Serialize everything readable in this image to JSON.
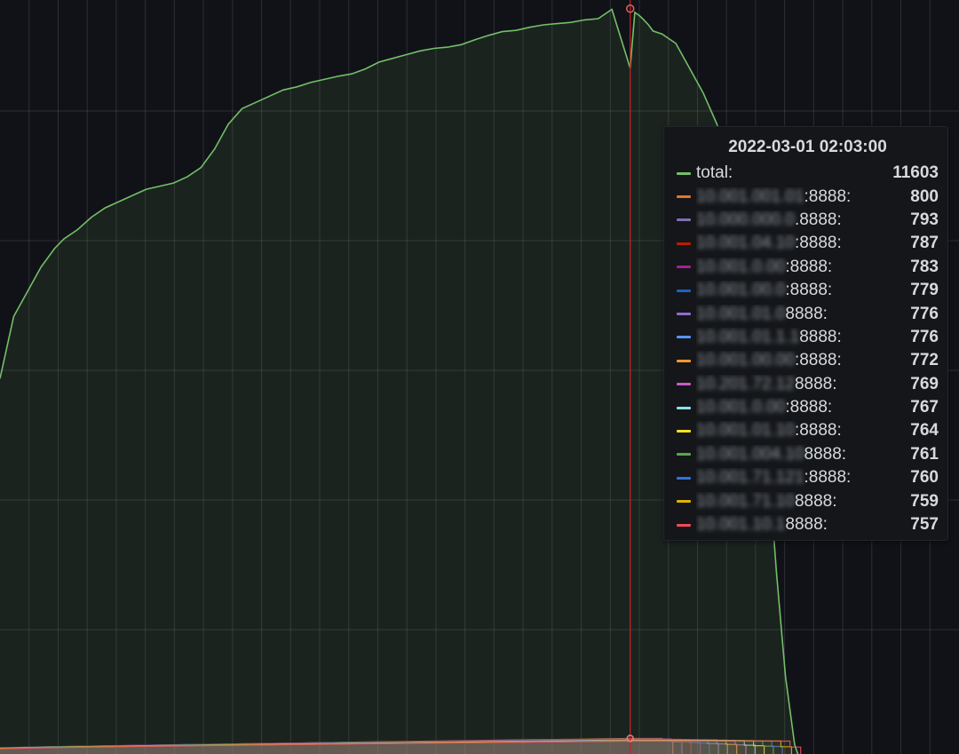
{
  "chart_data": {
    "type": "area",
    "x_range": [
      "2022-02-28 23:45:00",
      "2022-03-01 03:15:00"
    ],
    "hover_time": "2022-03-01 02:03:00",
    "grid": true,
    "series": [
      {
        "name": "total:",
        "color": "#73bf69",
        "points": [
          [
            "2022-02-28 23:45:00",
            6600
          ],
          [
            "2022-02-28 23:48:00",
            7600
          ],
          [
            "2022-02-28 23:51:00",
            8000
          ],
          [
            "2022-02-28 23:54:00",
            8400
          ],
          [
            "2022-02-28 23:57:00",
            8700
          ],
          [
            "2022-02-28 23:59:00",
            8850
          ],
          [
            "2022-03-01 00:02:00",
            9000
          ],
          [
            "2022-03-01 00:05:00",
            9200
          ],
          [
            "2022-03-01 00:08:00",
            9350
          ],
          [
            "2022-03-01 00:11:00",
            9450
          ],
          [
            "2022-03-01 00:14:00",
            9550
          ],
          [
            "2022-03-01 00:17:00",
            9650
          ],
          [
            "2022-03-01 00:20:00",
            9700
          ],
          [
            "2022-03-01 00:23:00",
            9750
          ],
          [
            "2022-03-01 00:26:00",
            9850
          ],
          [
            "2022-03-01 00:29:00",
            10000
          ],
          [
            "2022-03-01 00:32:00",
            10300
          ],
          [
            "2022-03-01 00:35:00",
            10700
          ],
          [
            "2022-03-01 00:38:00",
            10950
          ],
          [
            "2022-03-01 00:41:00",
            11050
          ],
          [
            "2022-03-01 00:44:00",
            11150
          ],
          [
            "2022-03-01 00:47:00",
            11250
          ],
          [
            "2022-03-01 00:50:00",
            11300
          ],
          [
            "2022-03-01 00:53:00",
            11370
          ],
          [
            "2022-03-01 00:56:00",
            11420
          ],
          [
            "2022-03-01 00:59:00",
            11470
          ],
          [
            "2022-03-01 01:02:00",
            11510
          ],
          [
            "2022-03-01 01:05:00",
            11590
          ],
          [
            "2022-03-01 01:08:00",
            11700
          ],
          [
            "2022-03-01 01:11:00",
            11760
          ],
          [
            "2022-03-01 01:14:00",
            11820
          ],
          [
            "2022-03-01 01:17:00",
            11880
          ],
          [
            "2022-03-01 01:20:00",
            11920
          ],
          [
            "2022-03-01 01:23:00",
            11940
          ],
          [
            "2022-03-01 01:26:00",
            11980
          ],
          [
            "2022-03-01 01:29:00",
            12060
          ],
          [
            "2022-03-01 01:32:00",
            12130
          ],
          [
            "2022-03-01 01:35:00",
            12190
          ],
          [
            "2022-03-01 01:38:00",
            12210
          ],
          [
            "2022-03-01 01:41:00",
            12260
          ],
          [
            "2022-03-01 01:44:00",
            12300
          ],
          [
            "2022-03-01 01:47:00",
            12320
          ],
          [
            "2022-03-01 01:50:00",
            12340
          ],
          [
            "2022-03-01 01:53:00",
            12380
          ],
          [
            "2022-03-01 01:56:00",
            12400
          ],
          [
            "2022-03-01 01:59:00",
            12550
          ],
          [
            "2022-03-01 02:03:00",
            11603
          ],
          [
            "2022-03-01 02:04:00",
            12500
          ],
          [
            "2022-03-01 02:05:00",
            12450
          ],
          [
            "2022-03-01 02:06:00",
            12380
          ],
          [
            "2022-03-01 02:07:00",
            12300
          ],
          [
            "2022-03-01 02:08:00",
            12200
          ],
          [
            "2022-03-01 02:10:00",
            12150
          ],
          [
            "2022-03-01 02:13:00",
            12000
          ],
          [
            "2022-03-01 02:16:00",
            11600
          ],
          [
            "2022-03-01 02:19:00",
            11200
          ],
          [
            "2022-03-01 02:22:00",
            10700
          ],
          [
            "2022-03-01 02:25:00",
            10000
          ],
          [
            "2022-03-01 02:28:00",
            9000
          ],
          [
            "2022-03-01 02:31:00",
            7500
          ],
          [
            "2022-03-01 02:33:00",
            5500
          ],
          [
            "2022-03-01 02:35:00",
            3500
          ],
          [
            "2022-03-01 02:37:00",
            1800
          ],
          [
            "2022-03-01 02:39:00",
            700
          ],
          [
            "2022-03-01 02:41:00",
            280
          ],
          [
            "2022-03-01 02:43:00",
            130
          ],
          [
            "2022-03-01 02:46:00",
            90
          ],
          [
            "2022-03-01 02:49:00",
            80
          ],
          [
            "2022-03-01 03:15:00",
            50
          ]
        ]
      }
    ],
    "instances": {
      "x_range": [
        "2022-02-28 23:45:00",
        "2022-03-01 02:03:00"
      ],
      "values_start": [
        640,
        645,
        650,
        642,
        648,
        636,
        639,
        644,
        638,
        641,
        637,
        646,
        633,
        640,
        635
      ],
      "end_times": [
        "2022-03-01 02:10:00",
        "2022-03-01 02:12:00",
        "2022-03-01 02:14:00",
        "2022-03-01 02:16:00",
        "2022-03-01 02:18:00",
        "2022-03-01 02:20:00",
        "2022-03-01 02:22:00",
        "2022-03-01 02:24:00",
        "2022-03-01 02:26:00",
        "2022-03-01 02:28:00",
        "2022-03-01 02:30:00",
        "2022-03-01 02:32:00",
        "2022-03-01 02:34:00",
        "2022-03-01 02:36:00",
        "2022-03-01 02:38:00"
      ]
    },
    "y_range": [
      550,
      12700
    ]
  },
  "tooltip": {
    "time": "2022-03-01 02:03:00",
    "rows": [
      {
        "label_prefix": "",
        "label": "total:",
        "value": "11603",
        "color": "#73bf69"
      },
      {
        "label_prefix": "10.001.001.01",
        "label": ":8888:",
        "value": "800",
        "color": "#e0752d"
      },
      {
        "label_prefix": "10.000.000.0",
        "label": ".8888:",
        "value": "793",
        "color": "#806eb7"
      },
      {
        "label_prefix": "10.001.04.10",
        "label": ":8888:",
        "value": "787",
        "color": "#bf1b00"
      },
      {
        "label_prefix": "10.001.0.00",
        "label": ":8888:",
        "value": "783",
        "color": "#a0248e"
      },
      {
        "label_prefix": "10.001.00.0",
        "label": ":8888:",
        "value": "779",
        "color": "#1f60c4"
      },
      {
        "label_prefix": "10.001.01.0",
        "label": "8888:",
        "value": "776",
        "color": "#8f6ccc"
      },
      {
        "label_prefix": "10.001.01.1.1",
        "label": "8888:",
        "value": "776",
        "color": "#5794f2"
      },
      {
        "label_prefix": "10.001.00.00",
        "label": ":8888:",
        "value": "772",
        "color": "#ff9830"
      },
      {
        "label_prefix": "10.201.72.12",
        "label": "8888:",
        "value": "769",
        "color": "#ca5ac8"
      },
      {
        "label_prefix": "10.001.0.00",
        "label": ":8888:",
        "value": "767",
        "color": "#8ae0ed"
      },
      {
        "label_prefix": "10.001.01.10",
        "label": ":8888:",
        "value": "764",
        "color": "#fade2a"
      },
      {
        "label_prefix": "10.001.004.10",
        "label": "8888:",
        "value": "761",
        "color": "#56a64b"
      },
      {
        "label_prefix": "10.001.71.121",
        "label": ":8888:",
        "value": "760",
        "color": "#3274d9"
      },
      {
        "label_prefix": "10.001.71.10",
        "label": "8888:",
        "value": "759",
        "color": "#e0b400"
      },
      {
        "label_prefix": "10.001.10.1",
        "label": "8888:",
        "value": "757",
        "color": "#f2495c"
      }
    ]
  }
}
